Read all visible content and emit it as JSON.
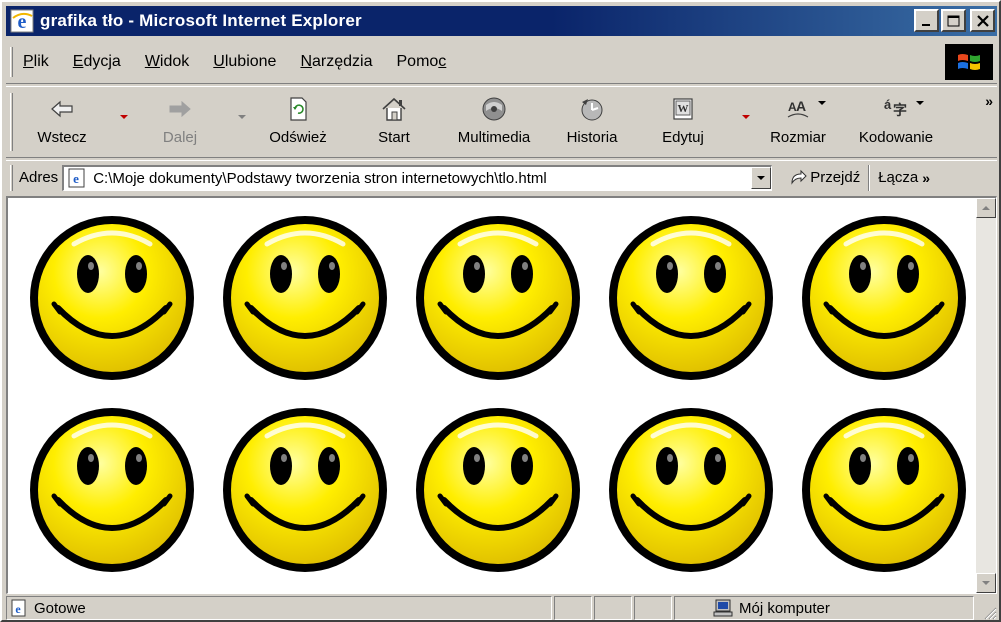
{
  "window": {
    "title": "grafika tło - Microsoft Internet Explorer",
    "controls": [
      "minimize",
      "maximize",
      "close"
    ]
  },
  "menu": {
    "items": [
      {
        "label": "Plik"
      },
      {
        "label": "Edycja"
      },
      {
        "label": "Widok"
      },
      {
        "label": "Ulubione"
      },
      {
        "label": "Narzędzia"
      },
      {
        "label": "Pomoc"
      }
    ]
  },
  "toolbar": {
    "buttons": [
      {
        "label": "Wstecz",
        "icon": "back-arrow-icon",
        "enabled": true,
        "dropdown": true
      },
      {
        "label": "Dalej",
        "icon": "forward-arrow-icon",
        "enabled": false,
        "dropdown": true
      },
      {
        "label": "Odśwież",
        "icon": "refresh-icon",
        "enabled": true
      },
      {
        "label": "Start",
        "icon": "home-icon",
        "enabled": true
      },
      {
        "label": "Multimedia",
        "icon": "multimedia-icon",
        "enabled": true
      },
      {
        "label": "Historia",
        "icon": "history-icon",
        "enabled": true
      },
      {
        "label": "Edytuj",
        "icon": "edit-icon",
        "enabled": true,
        "dropdown": true
      },
      {
        "label": "Rozmiar",
        "icon": "font-size-icon",
        "enabled": true,
        "dropdown": true
      },
      {
        "label": "Kodowanie",
        "icon": "encoding-icon",
        "enabled": true,
        "dropdown": true
      }
    ],
    "overflow": "»"
  },
  "address": {
    "label": "Adres",
    "value": "C:\\Moje dokumenty\\Podstawy tworzenia stron internetowych\\tlo.html",
    "go_label": "Przejdź",
    "links_label": "Łącza",
    "links_overflow": "»"
  },
  "content": {
    "background_image": "smiley-face-icon",
    "tile_rows": 2,
    "tile_cols": 5,
    "colors": {
      "face": "#ffee00",
      "outline": "#000000",
      "background": "#ffffff"
    }
  },
  "status": {
    "text": "Gotowe",
    "zone": "Mój komputer"
  },
  "colors": {
    "titlebar": "#0a246a",
    "chrome": "#d4d0c8"
  }
}
